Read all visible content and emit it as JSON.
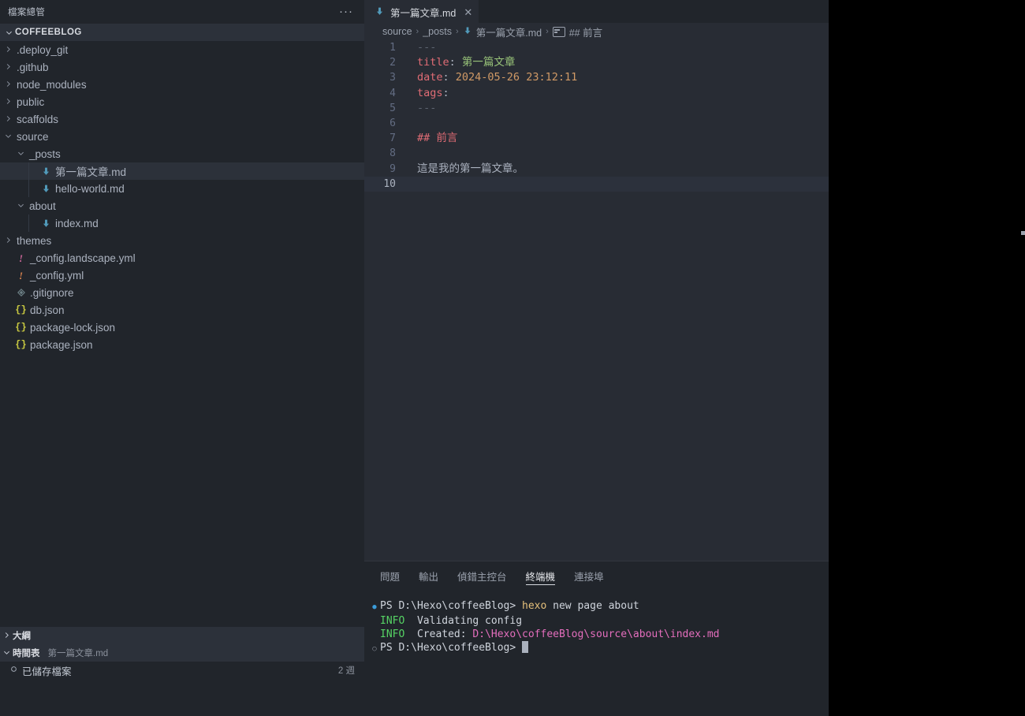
{
  "sidebar": {
    "title": "檔案總管",
    "more_label": "···",
    "root": {
      "label": "COFFEEBLOG",
      "expanded": true
    },
    "tree": [
      {
        "label": ".deploy_git",
        "type": "folder",
        "depth": 1,
        "expanded": false,
        "icon": "chevron-right-icon"
      },
      {
        "label": ".github",
        "type": "folder",
        "depth": 1,
        "expanded": false,
        "icon": "chevron-right-icon"
      },
      {
        "label": "node_modules",
        "type": "folder",
        "depth": 1,
        "expanded": false,
        "icon": "chevron-right-icon"
      },
      {
        "label": "public",
        "type": "folder",
        "depth": 1,
        "expanded": false,
        "icon": "chevron-right-icon"
      },
      {
        "label": "scaffolds",
        "type": "folder",
        "depth": 1,
        "expanded": false,
        "icon": "chevron-right-icon"
      },
      {
        "label": "source",
        "type": "folder",
        "depth": 1,
        "expanded": true,
        "icon": "chevron-down-icon"
      },
      {
        "label": "_posts",
        "type": "folder",
        "depth": 2,
        "expanded": true,
        "icon": "chevron-down-icon"
      },
      {
        "label": "第一篇文章.md",
        "type": "markdown",
        "depth": 3,
        "selected": true,
        "icon": "markdown-file-icon"
      },
      {
        "label": "hello-world.md",
        "type": "markdown",
        "depth": 3,
        "selected": false,
        "icon": "markdown-file-icon"
      },
      {
        "label": "about",
        "type": "folder",
        "depth": 2,
        "expanded": true,
        "icon": "chevron-down-icon"
      },
      {
        "label": "index.md",
        "type": "markdown",
        "depth": 3,
        "selected": false,
        "icon": "markdown-file-icon"
      },
      {
        "label": "themes",
        "type": "folder",
        "depth": 1,
        "expanded": false,
        "icon": "chevron-right-icon"
      },
      {
        "label": "_config.landscape.yml",
        "type": "yaml-a",
        "depth": 1,
        "icon": "yaml-file-icon"
      },
      {
        "label": "_config.yml",
        "type": "yaml-b",
        "depth": 1,
        "icon": "yaml-file-icon"
      },
      {
        "label": ".gitignore",
        "type": "git",
        "depth": 1,
        "icon": "git-file-icon"
      },
      {
        "label": "db.json",
        "type": "json",
        "depth": 1,
        "icon": "json-file-icon"
      },
      {
        "label": "package-lock.json",
        "type": "json",
        "depth": 1,
        "icon": "json-file-icon"
      },
      {
        "label": "package.json",
        "type": "json",
        "depth": 1,
        "icon": "json-file-icon"
      }
    ],
    "outline": {
      "label": "大綱",
      "expanded": false
    },
    "timeline": {
      "label": "時間表",
      "subtitle": "第一篇文章.md",
      "expanded": true,
      "entries": [
        {
          "icon": "save-circle-icon",
          "label": "已儲存檔案",
          "time": "2 週"
        }
      ]
    }
  },
  "editor": {
    "tab": {
      "label": "第一篇文章.md",
      "icon": "markdown-file-icon",
      "close_label": "✕",
      "active": true
    },
    "breadcrumb": [
      {
        "label": "source",
        "icon": ""
      },
      {
        "label": "_posts",
        "icon": ""
      },
      {
        "label": "第一篇文章.md",
        "icon": "markdown-file-icon"
      },
      {
        "label": "## 前言",
        "icon": "symbol-string-icon"
      }
    ],
    "breadcrumb_separator": "›",
    "lines": [
      {
        "n": "1",
        "tokens": [
          {
            "t": "---",
            "c": "t-dash"
          }
        ]
      },
      {
        "n": "2",
        "tokens": [
          {
            "t": "title",
            "c": "t-key"
          },
          {
            "t": ":",
            "c": "t-colon"
          },
          {
            "t": " 第一篇文章",
            "c": "t-str"
          }
        ]
      },
      {
        "n": "3",
        "tokens": [
          {
            "t": "date",
            "c": "t-key"
          },
          {
            "t": ":",
            "c": "t-colon"
          },
          {
            "t": " 2024-05-26 23:12:11",
            "c": "t-num"
          }
        ]
      },
      {
        "n": "4",
        "tokens": [
          {
            "t": "tags",
            "c": "t-key"
          },
          {
            "t": ":",
            "c": "t-colon"
          }
        ]
      },
      {
        "n": "5",
        "tokens": [
          {
            "t": "---",
            "c": "t-dash"
          }
        ]
      },
      {
        "n": "6",
        "tokens": []
      },
      {
        "n": "7",
        "tokens": [
          {
            "t": "## 前言",
            "c": "t-head"
          }
        ]
      },
      {
        "n": "8",
        "tokens": []
      },
      {
        "n": "9",
        "tokens": [
          {
            "t": "這是我的第一篇文章。",
            "c": "t-txt"
          }
        ]
      },
      {
        "n": "10",
        "tokens": [],
        "current": true
      }
    ]
  },
  "panel": {
    "tabs": [
      {
        "label": "問題",
        "active": false
      },
      {
        "label": "輸出",
        "active": false
      },
      {
        "label": "偵錯主控台",
        "active": false
      },
      {
        "label": "終端機",
        "active": true
      },
      {
        "label": "連接埠",
        "active": false
      }
    ],
    "terminal": [
      {
        "marker": "dot-filled",
        "segments": [
          {
            "t": "PS D:\\Hexo\\coffeeBlog> ",
            "c": "c-white"
          },
          {
            "t": "hexo",
            "c": "c-yellow"
          },
          {
            "t": " new page about",
            "c": "c-white"
          }
        ]
      },
      {
        "marker": "none",
        "segments": [
          {
            "t": "INFO ",
            "c": "c-green"
          },
          {
            "t": " Validating config",
            "c": "c-white"
          }
        ]
      },
      {
        "marker": "none",
        "segments": [
          {
            "t": "INFO ",
            "c": "c-green"
          },
          {
            "t": " Created: ",
            "c": "c-white"
          },
          {
            "t": "D:\\Hexo\\coffeeBlog\\source\\about\\index.md",
            "c": "c-magenta"
          }
        ]
      },
      {
        "marker": "dot-hollow",
        "segments": [
          {
            "t": "PS D:\\Hexo\\coffeeBlog> ",
            "c": "c-white"
          }
        ],
        "cursor": true
      }
    ]
  },
  "colors": {
    "sidebar_bg": "#21252b",
    "editor_bg": "#282c34",
    "selection_bg": "#2c313a",
    "accent_blue": "#519aba",
    "keyword_red": "#e06c75",
    "string_green": "#98c379",
    "number_orange": "#d19a66",
    "terminal_green": "#56d364",
    "terminal_magenta": "#e46ebd",
    "terminal_yellow": "#e5c07b"
  }
}
